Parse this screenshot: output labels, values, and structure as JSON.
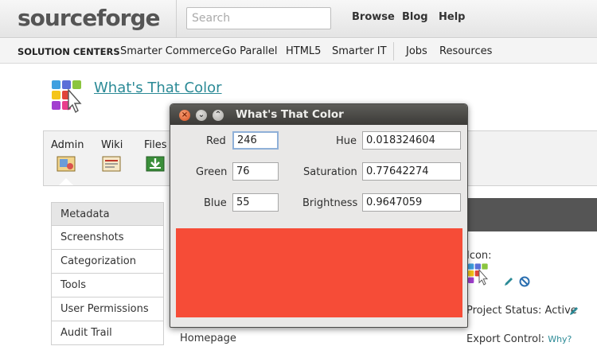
{
  "header": {
    "logo": "sourceforge",
    "search_placeholder": "Search",
    "nav": [
      "Browse",
      "Blog",
      "Help"
    ]
  },
  "solution_bar": {
    "title": "SOLUTION CENTERS",
    "items": [
      "Smarter Commerce",
      "Go Parallel",
      "HTML5",
      "Smarter IT"
    ],
    "right_items": [
      "Jobs",
      "Resources"
    ]
  },
  "project": {
    "title": "What's That Color"
  },
  "admin_tabs": [
    "Admin",
    "Wiki",
    "Files"
  ],
  "sidebar": {
    "items": [
      "Metadata",
      "Screenshots",
      "Categorization",
      "Tools",
      "User Permissions",
      "Audit Trail"
    ]
  },
  "right_panel": {
    "icon_label": "Icon:",
    "status_label": "Project Status: Active",
    "export_label": "Export Control:",
    "why_link": "Why?"
  },
  "homepage_label": "Homepage",
  "dialog": {
    "title": "What's That Color",
    "red_label": "Red",
    "red_value": "246",
    "green_label": "Green",
    "green_value": "76",
    "blue_label": "Blue",
    "blue_value": "55",
    "hue_label": "Hue",
    "hue_value": "0.018324604",
    "saturation_label": "Saturation",
    "saturation_value": "0.77642274",
    "brightness_label": "Brightness",
    "brightness_value": "0.9647059",
    "swatch_color": "#f64c37"
  },
  "colors": {
    "link": "#2b8a96",
    "swatch": "#f64c37"
  }
}
